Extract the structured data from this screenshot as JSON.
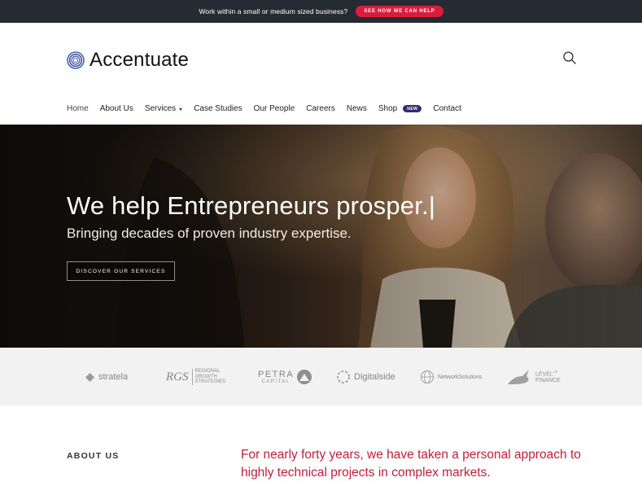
{
  "topbar": {
    "text": "Work within a small or medium sized business?",
    "cta": "SEE HOW WE CAN HELP"
  },
  "header": {
    "brand": "Accentuate",
    "nav": [
      {
        "label": "Home",
        "active": true
      },
      {
        "label": "About Us"
      },
      {
        "label": "Services",
        "has_dropdown": true
      },
      {
        "label": "Case Studies"
      },
      {
        "label": "Our People"
      },
      {
        "label": "Careers"
      },
      {
        "label": "News"
      },
      {
        "label": "Shop",
        "badge": "NEW"
      },
      {
        "label": "Contact"
      }
    ]
  },
  "hero": {
    "title": "We help Entrepreneurs prosper.|",
    "subtitle": "Bringing decades of proven industry expertise.",
    "cta": "DISCOVER OUR SERVICES"
  },
  "clients": [
    {
      "name": "stratela"
    },
    {
      "name": "RGS",
      "tagline_1": "REGIONAL",
      "tagline_2": "GROWTH",
      "tagline_3": "STRATEGIES"
    },
    {
      "name": "PETRA",
      "tagline": "CAPITAL"
    },
    {
      "name": "Digitalside"
    },
    {
      "name": "NetworkSolutions"
    },
    {
      "name": "LEVEL",
      "sup": "UP",
      "tagline": "FINANCE"
    }
  ],
  "about": {
    "label": "ABOUT US",
    "text": "For nearly forty years, we have taken a personal approach to highly technical projects in complex markets."
  },
  "colors": {
    "topbar_bg": "#262b33",
    "accent_red": "#d81e3c",
    "badge_purple": "#3b2a6e",
    "about_text": "#c0203c"
  }
}
